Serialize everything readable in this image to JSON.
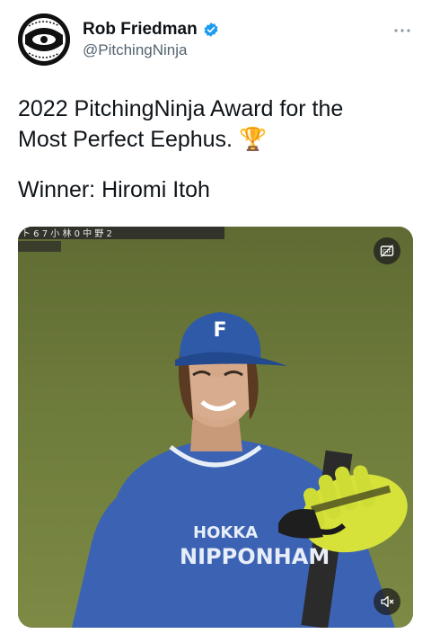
{
  "author": {
    "display_name": "Rob Friedman",
    "handle": "@PitchingNinja",
    "avatar": "ninja-avatar",
    "verified_icon": "verified-badge-icon",
    "verified_color": "#1d9bf0"
  },
  "tweet": {
    "line1": "2022 PitchingNinja Award for the",
    "line2": "Most Perfect Eephus. 🏆",
    "line3": "Winner: Hiromi Itoh"
  },
  "more_icon": "more-options-icon",
  "media": {
    "type": "gif",
    "alt_icon": "alt-text-icon",
    "mute_icon": "muted-speaker-icon",
    "jersey_text_top": "HOKKA",
    "jersey_text_bottom": "NIPPONHAM",
    "scoreboard_text": "ト 6 7 小 林 0 中 野 2"
  }
}
